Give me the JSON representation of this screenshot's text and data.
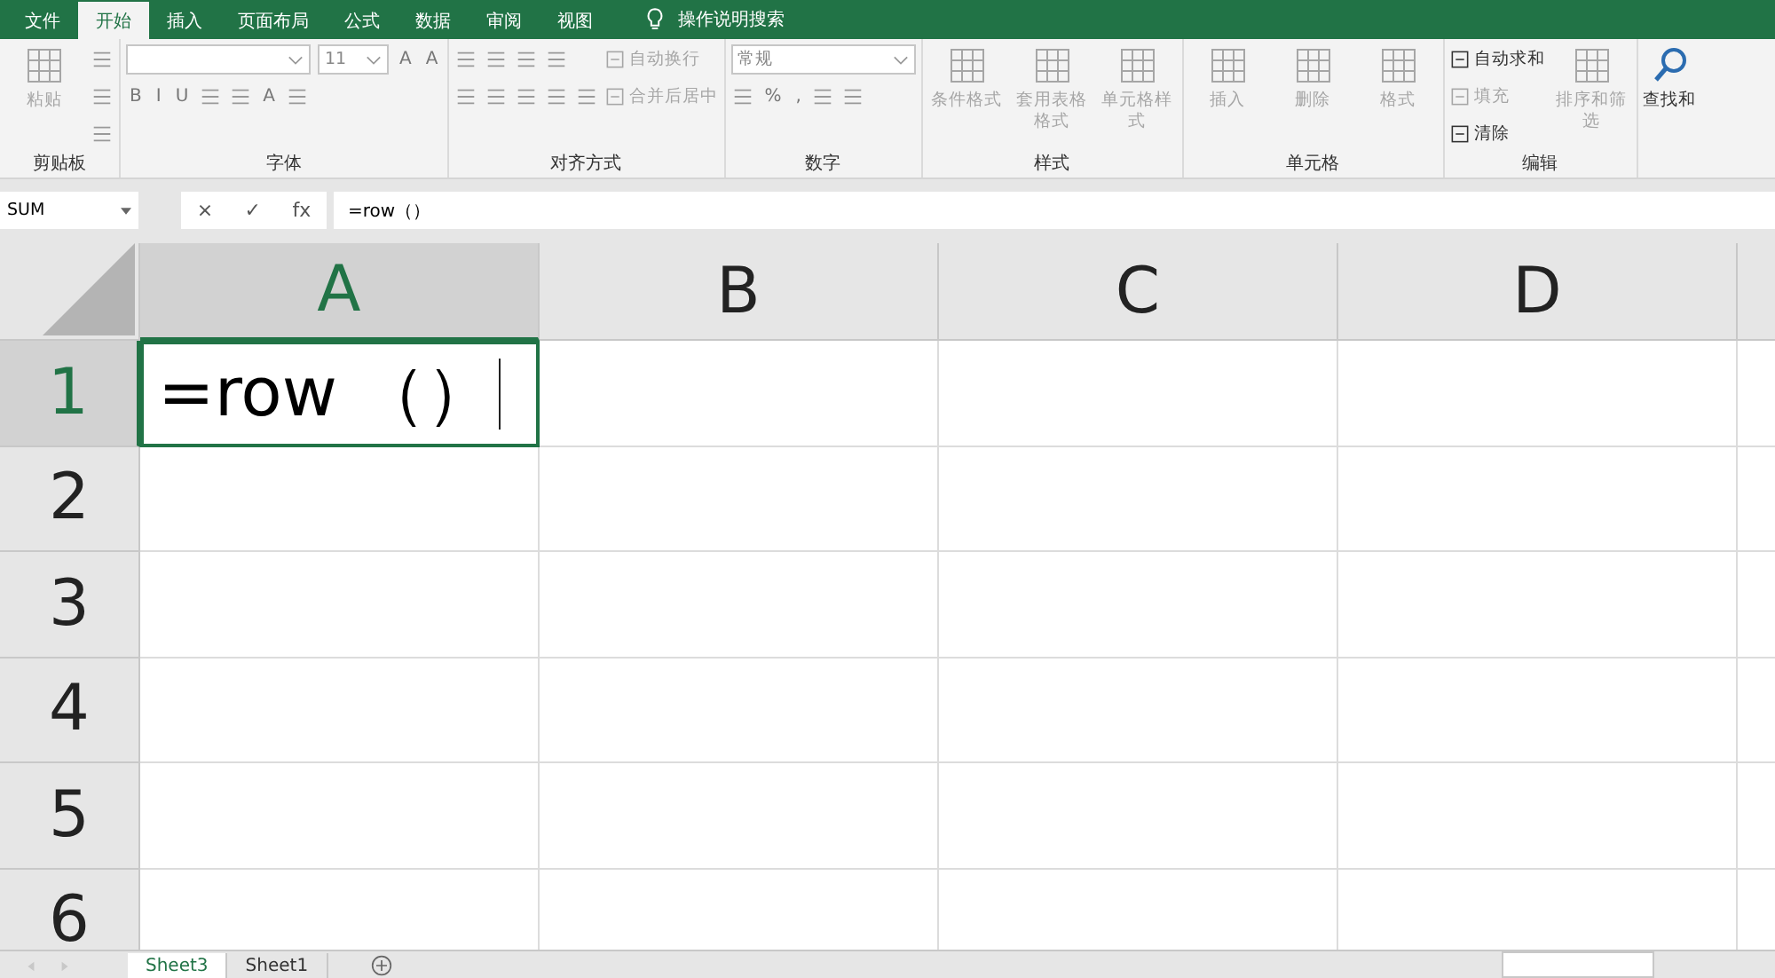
{
  "menu_tabs": [
    {
      "label": "文件",
      "selected": false
    },
    {
      "label": "开始",
      "selected": true
    },
    {
      "label": "插入",
      "selected": false
    },
    {
      "label": "页面布局",
      "selected": false
    },
    {
      "label": "公式",
      "selected": false
    },
    {
      "label": "数据",
      "selected": false
    },
    {
      "label": "审阅",
      "selected": false
    },
    {
      "label": "视图",
      "selected": false
    }
  ],
  "tell_me": {
    "placeholder": "操作说明搜索"
  },
  "ribbon": {
    "groups": [
      {
        "label": "剪贴板",
        "blocks": [
          {
            "kind": "large",
            "label": "粘贴",
            "disabled": true
          },
          {
            "kind": "stack",
            "rows": [
              [
                {
                  "kind": "icon"
                }
              ],
              [
                {
                  "kind": "icon"
                }
              ],
              [
                {
                  "kind": "icon"
                }
              ]
            ]
          }
        ]
      },
      {
        "label": "字体",
        "blocks": [
          {
            "kind": "stack",
            "rows": [
              [
                {
                  "kind": "field"
                },
                {
                  "kind": "field",
                  "value": "11"
                },
                {
                  "kind": "glyph",
                  "label": "A"
                },
                {
                  "kind": "glyph",
                  "label": "A"
                }
              ],
              [
                {
                  "kind": "glyph",
                  "label": "B"
                },
                {
                  "kind": "glyph",
                  "label": "I"
                },
                {
                  "kind": "glyph",
                  "label": "U"
                },
                {
                  "kind": "icon"
                },
                {
                  "kind": "icon"
                },
                {
                  "kind": "glyph",
                  "label": "A"
                },
                {
                  "kind": "icon"
                }
              ]
            ]
          }
        ]
      },
      {
        "label": "对齐方式",
        "blocks": [
          {
            "kind": "stack",
            "rows": [
              [
                {
                  "kind": "icon"
                },
                {
                  "kind": "icon"
                },
                {
                  "kind": "icon"
                },
                {
                  "kind": "icon"
                }
              ],
              [
                {
                  "kind": "icon"
                },
                {
                  "kind": "icon"
                },
                {
                  "kind": "icon"
                },
                {
                  "kind": "icon"
                },
                {
                  "kind": "icon"
                }
              ]
            ]
          },
          {
            "kind": "stack",
            "rows": [
              [
                {
                  "kind": "small",
                  "label": "自动换行",
                  "disabled": true
                }
              ],
              [
                {
                  "kind": "small",
                  "label": "合并后居中",
                  "disabled": true
                }
              ]
            ]
          }
        ]
      },
      {
        "label": "数字",
        "blocks": [
          {
            "kind": "stack",
            "rows": [
              [
                {
                  "kind": "field",
                  "value": "常规"
                }
              ],
              [
                {
                  "kind": "icon"
                },
                {
                  "kind": "glyph",
                  "label": "%"
                },
                {
                  "kind": "glyph",
                  "label": ","
                },
                {
                  "kind": "icon"
                },
                {
                  "kind": "icon"
                }
              ]
            ]
          }
        ]
      },
      {
        "label": "样式",
        "blocks": [
          {
            "kind": "large",
            "label": "条件格式",
            "disabled": true
          },
          {
            "kind": "large",
            "label": "套用表格格式",
            "disabled": true
          },
          {
            "kind": "large",
            "label": "单元格样式",
            "disabled": true
          }
        ]
      },
      {
        "label": "单元格",
        "blocks": [
          {
            "kind": "large",
            "label": "插入",
            "disabled": true
          },
          {
            "kind": "large",
            "label": "删除",
            "disabled": true
          },
          {
            "kind": "large",
            "label": "格式",
            "disabled": true
          }
        ]
      },
      {
        "label": "编辑",
        "blocks": [
          {
            "kind": "stack",
            "rows": [
              [
                {
                  "kind": "small",
                  "label": "自动求和",
                  "disabled": false
                }
              ],
              [
                {
                  "kind": "small",
                  "label": "填充",
                  "disabled": true
                }
              ],
              [
                {
                  "kind": "small",
                  "label": "清除",
                  "disabled": false
                }
              ]
            ]
          },
          {
            "kind": "large",
            "label": "排序和筛选",
            "disabled": true
          }
        ]
      },
      {
        "blocks": [
          {
            "kind": "finder",
            "label": "查找和",
            "disabled": false
          }
        ]
      }
    ]
  },
  "formula_bar": {
    "name_box": "SUM",
    "buttons": [
      "×",
      "✓",
      "fx"
    ],
    "formula": "=row（）"
  },
  "grid": {
    "columns": [
      {
        "label": "A",
        "selected": true
      },
      {
        "label": "B",
        "selected": false
      },
      {
        "label": "C",
        "selected": false
      },
      {
        "label": "D",
        "selected": false
      }
    ],
    "rows": [
      {
        "label": "1",
        "selected": true,
        "cells": [
          "=row （）",
          "",
          "",
          ""
        ]
      },
      {
        "label": "2",
        "selected": false,
        "cells": [
          "",
          "",
          "",
          ""
        ]
      },
      {
        "label": "3",
        "selected": false,
        "cells": [
          "",
          "",
          "",
          ""
        ]
      },
      {
        "label": "4",
        "selected": false,
        "cells": [
          "",
          "",
          "",
          ""
        ]
      },
      {
        "label": "5",
        "selected": false,
        "cells": [
          "",
          "",
          "",
          ""
        ]
      },
      {
        "label": "6",
        "selected": false,
        "cells": [
          "",
          "",
          "",
          ""
        ]
      }
    ]
  },
  "sheet_tabs": [
    {
      "label": "Sheet3",
      "selected": true
    },
    {
      "label": "Sheet1",
      "selected": false
    }
  ]
}
